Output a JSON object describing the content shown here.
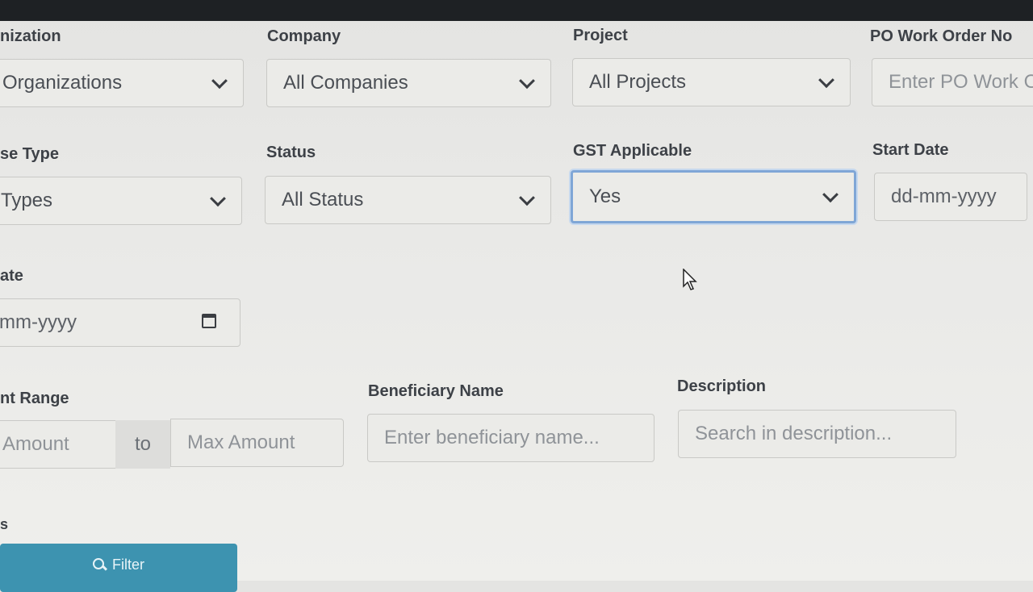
{
  "row1": {
    "organization": {
      "label": "nization",
      "value": "Organizations"
    },
    "company": {
      "label": "Company",
      "value": "All Companies"
    },
    "project": {
      "label": "Project",
      "value": "All Projects"
    },
    "po_work_order": {
      "label": "PO Work Order No",
      "placeholder": "Enter PO Work O"
    }
  },
  "row2": {
    "expense_type": {
      "label": "se Type",
      "value": "Types"
    },
    "status": {
      "label": "Status",
      "value": "All Status"
    },
    "gst_applicable": {
      "label": "GST Applicable",
      "value": "Yes"
    },
    "start_date": {
      "label": "Start Date",
      "placeholder": "dd-mm-yyyy"
    }
  },
  "row3": {
    "end_date": {
      "label": "ate",
      "placeholder": "mm-yyyy"
    }
  },
  "row4": {
    "amount_range": {
      "label": "nt Range",
      "min_placeholder": "Amount",
      "to_text": "to",
      "max_placeholder": "Max Amount"
    },
    "beneficiary": {
      "label": "Beneficiary Name",
      "placeholder": "Enter beneficiary name..."
    },
    "description": {
      "label": "Description",
      "placeholder": "Search in description..."
    }
  },
  "stray_text": "s",
  "filter_button": {
    "label": "Filter",
    "icon": "search-icon"
  },
  "colors": {
    "accent": "#3d93b0",
    "focus": "#7fa6d6",
    "topbar": "#1e2124"
  }
}
